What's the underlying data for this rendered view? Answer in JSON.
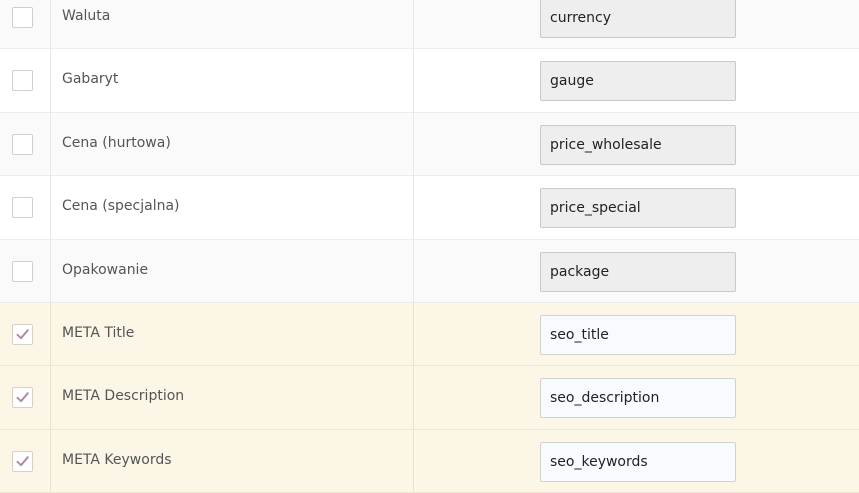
{
  "rows": [
    {
      "label": "Waluta",
      "value": "currency",
      "checked": false
    },
    {
      "label": "Gabaryt",
      "value": "gauge",
      "checked": false
    },
    {
      "label": "Cena (hurtowa)",
      "value": "price_wholesale",
      "checked": false
    },
    {
      "label": "Cena (specjalna)",
      "value": "price_special",
      "checked": false
    },
    {
      "label": "Opakowanie",
      "value": "package",
      "checked": false
    },
    {
      "label": "META Title",
      "value": "seo_title",
      "checked": true
    },
    {
      "label": "META Description",
      "value": "seo_description",
      "checked": true
    },
    {
      "label": "META Keywords",
      "value": "seo_keywords",
      "checked": true
    }
  ],
  "colors": {
    "checkmark": "#b48aa6",
    "checked_row_bg": "#fcf6e6",
    "disabled_field_bg": "#eeeeee",
    "enabled_field_bg": "#f7fbff"
  }
}
